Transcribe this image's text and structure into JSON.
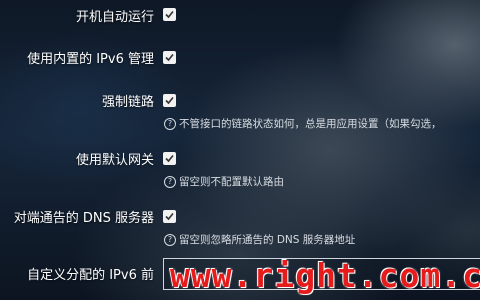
{
  "settings": {
    "auto_run": {
      "label": "开机自动运行",
      "checked": true
    },
    "builtin_ipv6": {
      "label": "使用内置的 IPv6 管理",
      "checked": true
    },
    "force_link": {
      "label": "强制链路",
      "checked": true,
      "help": "不管接口的链路状态如何，总是用应用设置（如果勾选，"
    },
    "default_gateway": {
      "label": "使用默认网关",
      "checked": true,
      "help": "留空则不配置默认路由"
    },
    "peer_dns": {
      "label": "对端通告的 DNS 服务器",
      "checked": true,
      "help": "留空则忽略所通告的 DNS 服务器地址"
    },
    "ipv6_assign": {
      "label": "自定义分配的 IPv6 前"
    }
  },
  "watermark": "www.right.com.c",
  "colors": {
    "watermark": "#e61b1b",
    "checkbox": "#f2f2f2",
    "text": "#ffffff"
  }
}
